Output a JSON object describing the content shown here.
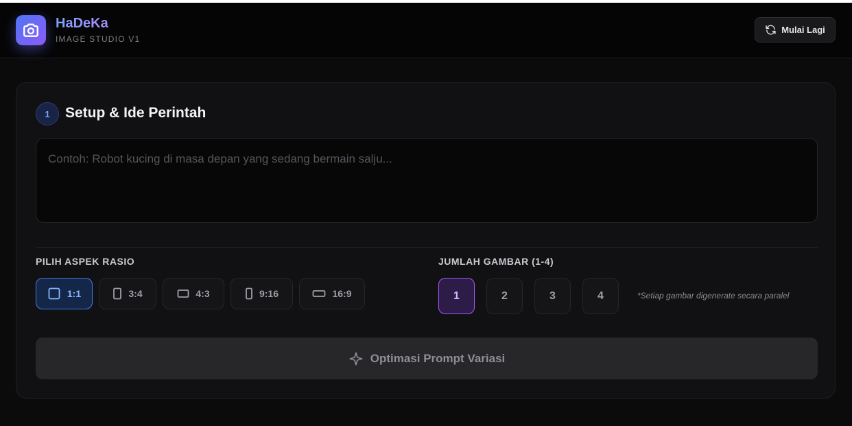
{
  "app": {
    "name": "HaDeKa",
    "subtitle": "IMAGE STUDIO V1",
    "logo_icon": "camera-icon",
    "accent_colors": {
      "blue": "#4f74f5",
      "purple": "#8b5cf6"
    }
  },
  "header": {
    "restart_label": "Mulai Lagi",
    "restart_icon": "refresh-icon"
  },
  "step1": {
    "number": "1",
    "title": "Setup & Ide Perintah",
    "prompt": {
      "value": "",
      "placeholder": "Contoh: Robot kucing di masa depan yang sedang bermain salju..."
    },
    "aspect": {
      "label": "PILIH ASPEK RASIO",
      "selected": "1:1",
      "options": [
        {
          "label": "1:1",
          "icon": "square-icon"
        },
        {
          "label": "3:4",
          "icon": "portrait-rect-icon"
        },
        {
          "label": "4:3",
          "icon": "landscape-rect-icon"
        },
        {
          "label": "9:16",
          "icon": "tall-rect-icon"
        },
        {
          "label": "16:9",
          "icon": "wide-rect-icon"
        }
      ]
    },
    "count": {
      "label": "JUMLAH GAMBAR (1-4)",
      "selected": "1",
      "options": [
        "1",
        "2",
        "3",
        "4"
      ],
      "note": "*Setiap gambar digenerate secara paralel"
    },
    "optimize_label": "Optimasi Prompt Variasi",
    "optimize_icon": "sparkle-icon"
  }
}
